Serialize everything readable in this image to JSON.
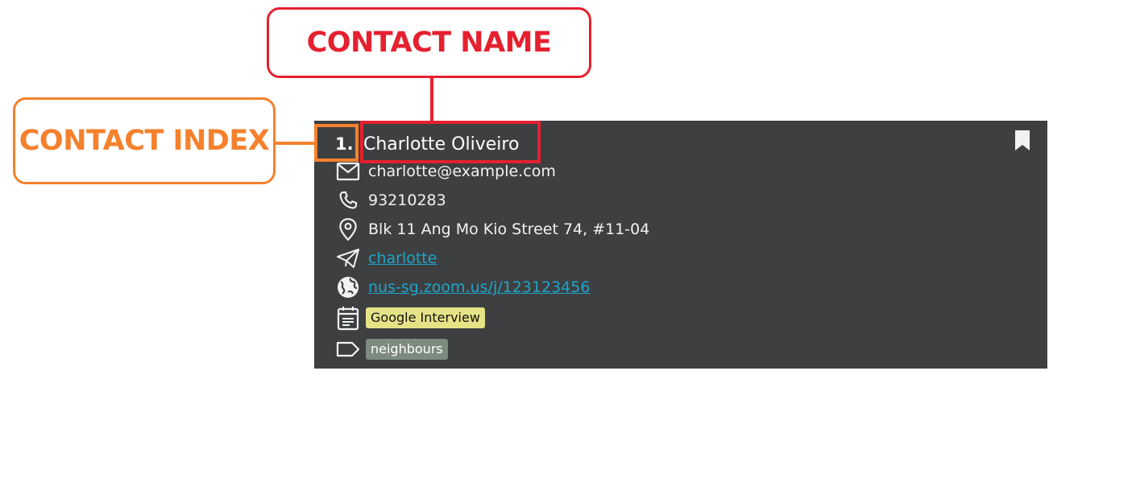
{
  "annotations": {
    "contact_name_label": "CONTACT NAME",
    "contact_index_label": "CONTACT INDEX",
    "name_color": "#e5202f",
    "index_color": "#f5812d"
  },
  "contact": {
    "index": "1.",
    "name": "Charlotte Oliveiro",
    "email": "charlotte@example.com",
    "phone": "93210283",
    "address": "Blk 11 Ang Mo Kio Street 74, #11-04",
    "telegram": "charlotte",
    "meeting_link": "nus-sg.zoom.us/j/123123456",
    "event_tag": "Google Interview",
    "tag": "neighbours",
    "bookmark_icon": "bookmark-icon"
  },
  "colors": {
    "card_background": "#3e3f41",
    "link": "#1fa5c8",
    "event_chip": "#e6e286",
    "tag_chip": "#7d8a80"
  }
}
